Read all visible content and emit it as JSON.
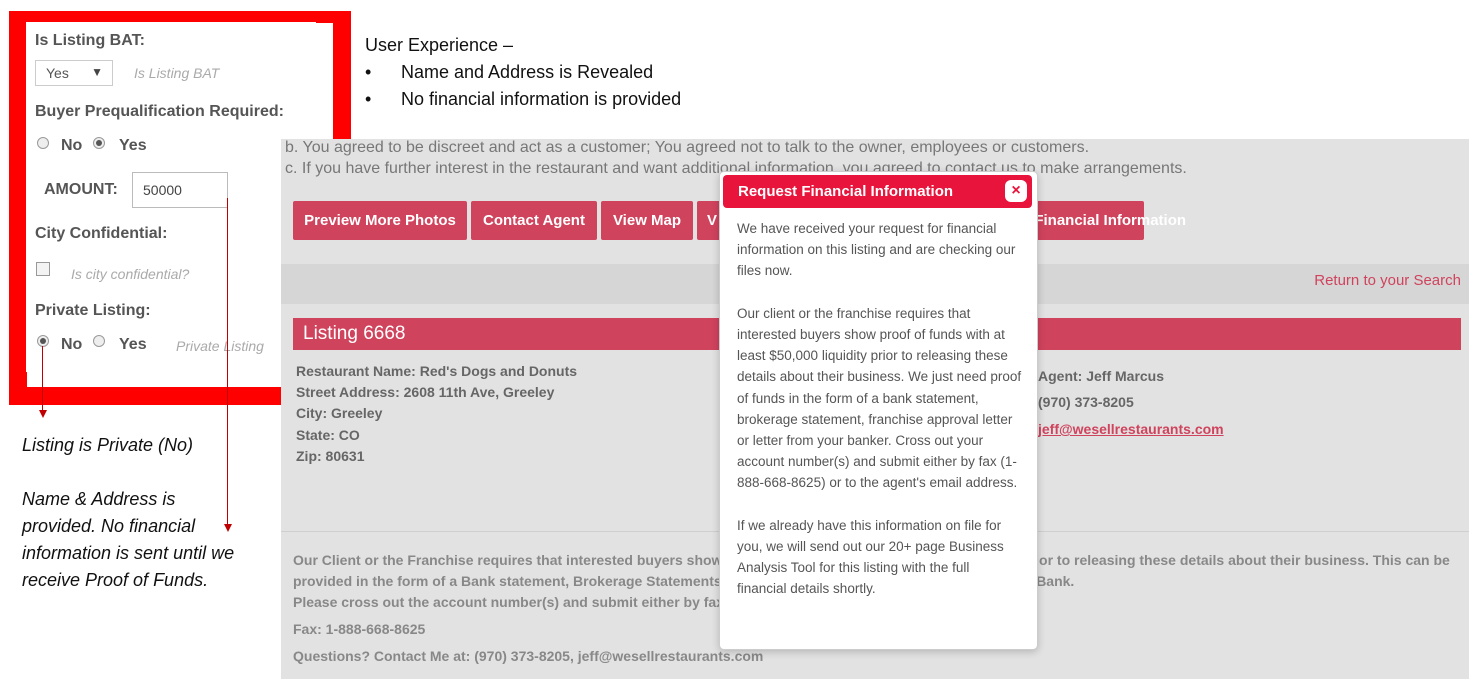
{
  "form": {
    "is_listing_bat_label": "Is Listing BAT:",
    "is_listing_bat_value": "Yes",
    "is_listing_bat_arrow": "▼",
    "is_listing_bat_hint": "Is Listing BAT",
    "buyer_prequal_label": "Buyer Prequalification Required:",
    "buyer_prequal_no": "No",
    "buyer_prequal_yes": "Yes",
    "buyer_prequal_selected": "Yes",
    "amount_label": "AMOUNT:",
    "amount_value": "50000",
    "city_confidential_label": "City Confidential:",
    "city_confidential_hint": "Is city confidential?",
    "city_confidential_checked": false,
    "private_listing_label": "Private Listing:",
    "private_no": "No",
    "private_yes": "Yes",
    "private_selected": "No",
    "private_hint": "Private Listing"
  },
  "annotation": {
    "title": "User Experience –",
    "bullets": [
      "Name and Address is Revealed",
      "No financial information is provided"
    ],
    "bullet_glyph": "•",
    "note_line1": "Listing is Private (No)",
    "note_para": [
      "Name & Address is",
      "provided. No financial",
      "information is sent until we",
      "receive Proof of Funds."
    ],
    "arrow_color": "#c00000"
  },
  "site": {
    "agreement_b": "b. You agreed to be discreet and act as a customer; You agreed not to talk to the owner, employees or customers.",
    "agreement_c": "c. If you have further interest in the restaurant and want additional information, you agreed to contact us to make arrangements.",
    "buttons": [
      "Preview More Photos",
      "Contact Agent",
      "View Map",
      "V",
      "Request Financial Information"
    ],
    "button_color": "#d0435d",
    "return_link": "Return to your Search",
    "listing_title": "Listing 6668",
    "details": {
      "restaurant_name": "Restaurant Name: Red's Dogs and Donuts",
      "street": "Street Address: 2608 11th Ave, Greeley",
      "city": "City: Greeley",
      "state": "State: CO",
      "zip": "Zip: 80631"
    },
    "agent": {
      "name": "Agent: Jeff Marcus",
      "phone": "(970) 373-8205",
      "email": "jeff@wesellrestaurants.com"
    },
    "fine_print": [
      "Our Client or the Franchise requires that interested buyers show proof of funds with at least $50,000 liquidity prior to releasing these details about their business. This can be",
      "provided in the form of a Bank statement, Brokerage Statements, Franchise Approval Letter or Letter from your Bank.",
      "Please cross out the account number(s) and submit either by fax or to the agent's email address."
    ],
    "fax": "Fax: 1-888-668-8625",
    "questions": "Questions?   Contact Me at: (970) 373-8205, jeff@wesellrestaurants.com"
  },
  "modal": {
    "title": "Request Financial Information",
    "close": "×",
    "header_color": "#e8143c",
    "paragraphs": [
      "We have received your request for financial information on this listing and are checking our files now.",
      "Our client or the franchise requires that interested buyers show proof of funds with at least $50,000 liquidity prior to releasing these details about their business. We just need proof of funds in the form of a bank statement, brokerage statement, franchise approval letter or letter from your banker. Cross out your account number(s) and submit either by fax (1-888-668-8625) or to the agent's email address.",
      "If we already have this information on file for you, we will send out our 20+ page Business Analysis Tool for this listing with the full financial details shortly."
    ]
  }
}
